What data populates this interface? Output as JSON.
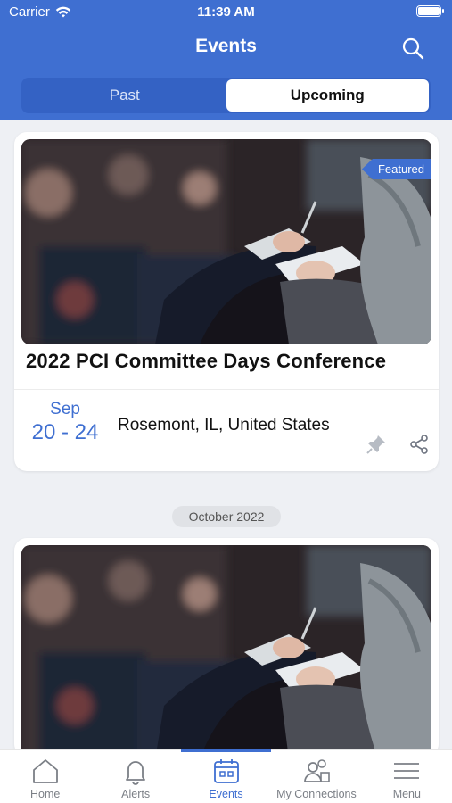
{
  "status_bar": {
    "carrier": "Carrier",
    "time": "11:39 AM"
  },
  "header": {
    "title": "Events"
  },
  "tabs": {
    "past": "Past",
    "upcoming": "Upcoming"
  },
  "events": [
    {
      "badge": "Featured",
      "title": "2022 PCI Committee Days Conference",
      "month": "Sep",
      "days": "20 - 24",
      "location": "Rosemont, IL, United States"
    }
  ],
  "section_header": "October 2022",
  "tabbar": {
    "home": "Home",
    "alerts": "Alerts",
    "events": "Events",
    "connections": "My Connections",
    "menu": "Menu"
  },
  "colors": {
    "accent": "#3f6fd1",
    "background": "#eef0f4"
  }
}
